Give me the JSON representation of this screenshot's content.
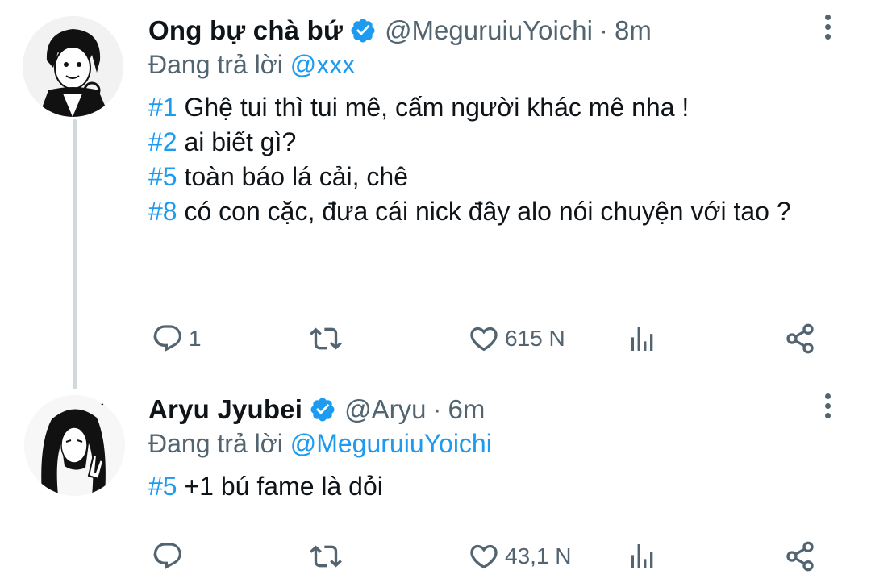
{
  "tweets": [
    {
      "author": {
        "name": "Ong bự chà bứ",
        "handle": "@MeguruiuYoichi"
      },
      "time": "8m",
      "dot": "·",
      "reply_prefix": "Đang trả lời",
      "reply_to": "@xxx",
      "lines": [
        {
          "tag": "#1",
          "text": " Ghệ tui thì tui mê, cấm người khác mê nha !"
        },
        {
          "tag": "#2",
          "text": " ai biết gì?"
        },
        {
          "tag": "#5",
          "text": " toàn báo lá cải, chê"
        },
        {
          "tag": "#8",
          "text": " có con cặc, đưa cái nick đây alo nói chuyện với tao ?"
        }
      ],
      "stats": {
        "replies": "1",
        "retweets": "",
        "likes": "615 N"
      }
    },
    {
      "author": {
        "name": "Aryu Jyubei",
        "handle": "@Aryu"
      },
      "time": "6m",
      "dot": "·",
      "reply_prefix": "Đang trả lời",
      "reply_to": "@MeguruiuYoichi",
      "lines": [
        {
          "tag": "#5",
          "text": " +1 bú fame là dỏi"
        }
      ],
      "stats": {
        "replies": "",
        "retweets": "",
        "likes": "43,1 N"
      }
    }
  ],
  "colors": {
    "accent": "#1d9bf0",
    "muted": "#536471",
    "text": "#0f1419",
    "thread_line": "#cfd9de"
  },
  "icons": [
    "verified-badge-icon",
    "more-options-icon",
    "reply-icon",
    "retweet-icon",
    "like-icon",
    "analytics-icon",
    "share-icon"
  ]
}
